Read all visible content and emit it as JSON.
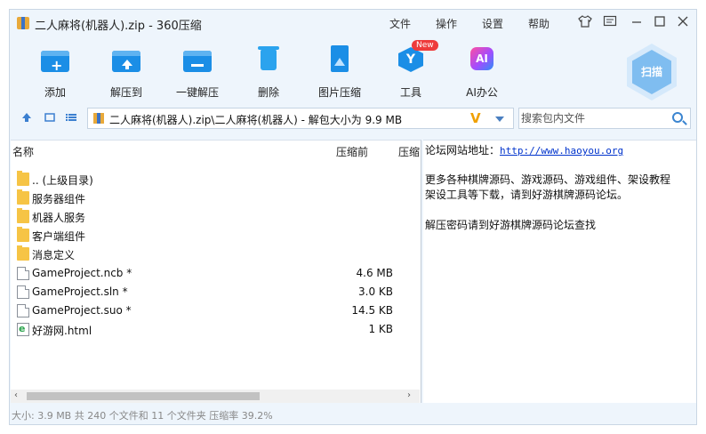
{
  "window": {
    "title": "二人麻将(机器人).zip - 360压缩",
    "menu": [
      "文件",
      "操作",
      "设置",
      "帮助"
    ]
  },
  "toolbar": {
    "tools": [
      {
        "label": "添加",
        "icon": "add-icon"
      },
      {
        "label": "解压到",
        "icon": "extract-to-icon"
      },
      {
        "label": "一键解压",
        "icon": "one-click-extract-icon"
      },
      {
        "label": "删除",
        "icon": "delete-icon"
      },
      {
        "label": "图片压缩",
        "icon": "image-compress-icon"
      },
      {
        "label": "工具",
        "icon": "tools-icon",
        "badge": "New"
      },
      {
        "label": "AI办公",
        "icon": "ai-office-icon",
        "icon_text": "AI"
      }
    ],
    "scan_label": "扫描"
  },
  "address": {
    "path": "二人麻将(机器人).zip\\二人麻将(机器人) - 解包大小为 9.9 MB",
    "search_placeholder": "搜索包内文件"
  },
  "filelist": {
    "columns": {
      "name": "名称",
      "size": "压缩前",
      "packed": "压缩"
    },
    "rows": [
      {
        "name": ".. (上级目录)",
        "type": "folder",
        "size": ""
      },
      {
        "name": "服务器组件",
        "type": "folder",
        "size": ""
      },
      {
        "name": "机器人服务",
        "type": "folder",
        "size": ""
      },
      {
        "name": "客户端组件",
        "type": "folder",
        "size": ""
      },
      {
        "name": "消息定义",
        "type": "folder",
        "size": ""
      },
      {
        "name": "GameProject.ncb *",
        "type": "file",
        "size": "4.6 MB"
      },
      {
        "name": "GameProject.sln *",
        "type": "file",
        "size": "3.0 KB"
      },
      {
        "name": "GameProject.suo *",
        "type": "file",
        "size": "14.5 KB"
      },
      {
        "name": "好游网.html",
        "type": "html",
        "size": "1 KB"
      }
    ]
  },
  "comment": {
    "forum_label": "论坛网站地址：",
    "forum_url": "http://www.haoyou.org",
    "line2": "更多各种棋牌源码、游戏源码、游戏组件、架设教程",
    "line3": "架设工具等下载，请到好游棋牌源码论坛。",
    "line4": "解压密码请到好游棋牌源码论坛查找"
  },
  "status": {
    "text": "大小: 3.9 MB 共 240 个文件和 11 个文件夹 压缩率 39.2%"
  }
}
